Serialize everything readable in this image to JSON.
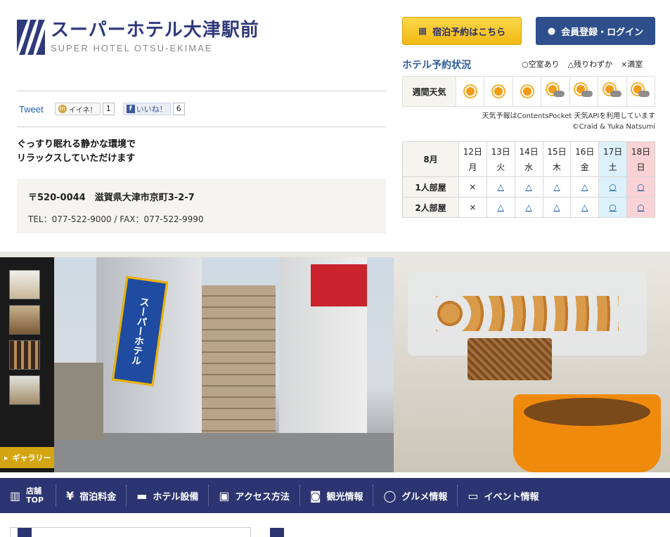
{
  "header": {
    "hotel_name": "スーパーホテル大津駅前",
    "hotel_name_en": "SUPER HOTEL OTSU-EKIMAE"
  },
  "buttons": {
    "reserve": "宿泊予約はこちら",
    "member": "会員登録・ログイン"
  },
  "social": {
    "tweet": "Tweet",
    "iine_label": "イイネ！",
    "iine_count": "1",
    "fb_label": "いいね！",
    "fb_count": "6"
  },
  "tagline": {
    "line1": "ぐっすり眠れる静かな環境で",
    "line2": "リラックスしていただけます"
  },
  "address": {
    "postal": "〒520-0044　滋賀県大津市京町3-2-7",
    "phone": "TEL：077-522-9000 / FAX：077-522-9990"
  },
  "reservation": {
    "title": "ホテル予約状況",
    "legend": [
      "○空室あり",
      "△残りわずか",
      "×満室"
    ],
    "weather_label": "週間天気",
    "weather": [
      "sun-icon",
      "sun-icon",
      "sun-icon",
      "sun-cloud-icon",
      "sun-cloud-icon",
      "sun-cloud-icon",
      "sun-cloud-icon"
    ],
    "credit1": "天気予報はContentsPocket 天気APIを利用しています",
    "credit2": "©Craid & Yuka Natsumi",
    "month": "8月",
    "days": [
      {
        "date": "12日",
        "dow": "月"
      },
      {
        "date": "13日",
        "dow": "火"
      },
      {
        "date": "14日",
        "dow": "水"
      },
      {
        "date": "15日",
        "dow": "木"
      },
      {
        "date": "16日",
        "dow": "金"
      },
      {
        "date": "17日",
        "dow": "土"
      },
      {
        "date": "18日",
        "dow": "日"
      }
    ],
    "rows": [
      {
        "label": "1人部屋",
        "cells": [
          "×",
          "△",
          "△",
          "△",
          "△",
          "○",
          "○"
        ]
      },
      {
        "label": "2人部屋",
        "cells": [
          "×",
          "△",
          "△",
          "△",
          "△",
          "○",
          "○"
        ]
      }
    ]
  },
  "gallery": {
    "button": "ギャラリー",
    "sign_text": "スーパーホテル"
  },
  "nav": [
    {
      "label": "店舗TOP",
      "icon": "building-icon"
    },
    {
      "label": "宿泊料金",
      "icon": "yen-icon"
    },
    {
      "label": "ホテル設備",
      "icon": "bed-icon"
    },
    {
      "label": "アクセス方法",
      "icon": "map-icon"
    },
    {
      "label": "観光情報",
      "icon": "camera-icon"
    },
    {
      "label": "グルメ情報",
      "icon": "dish-icon"
    },
    {
      "label": "イベント情報",
      "icon": "speech-bubble-icon"
    }
  ]
}
